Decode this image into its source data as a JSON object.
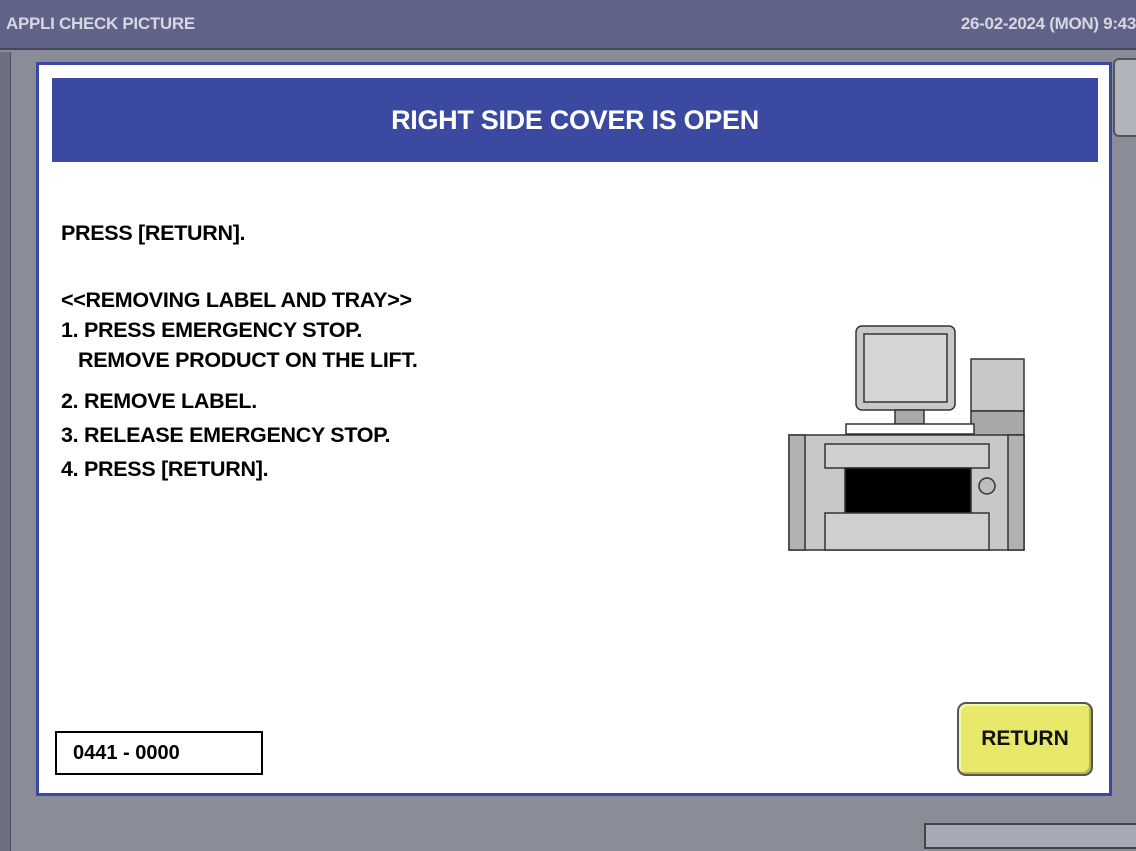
{
  "topbar": {
    "title": "APPLI CHECK PICTURE",
    "datetime": "26-02-2024 (MON)  9:43"
  },
  "dialog": {
    "header": "RIGHT SIDE COVER IS OPEN",
    "lines": [
      "PRESS [RETURN].",
      "<<REMOVING LABEL AND TRAY>>",
      "1. PRESS EMERGENCY STOP.",
      "   REMOVE PRODUCT ON THE LIFT.",
      "2. REMOVE LABEL.",
      "3. RELEASE EMERGENCY STOP.",
      "4. PRESS [RETURN]."
    ],
    "code": "0441 - 0000",
    "return_label": "RETURN"
  },
  "colors": {
    "accent": "#3b4aa0",
    "button": "#e8e86a",
    "topbar": "#5f6387"
  },
  "illustration": "machine-icon"
}
